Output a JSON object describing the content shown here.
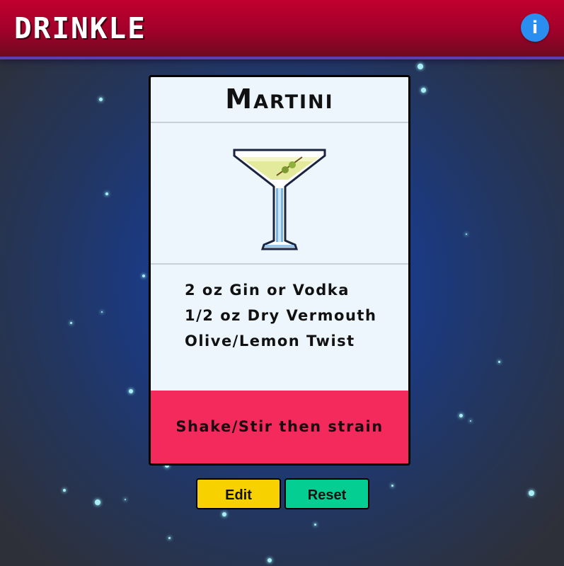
{
  "header": {
    "logo_text": "DRINKLE",
    "info_icon": "info-icon",
    "info_label": "i"
  },
  "card": {
    "title": "Martini",
    "image_icon": "martini-glass-icon",
    "ingredients": [
      "2 oz Gin or Vodka",
      "1/2 oz Dry Vermouth",
      "Olive/Lemon Twist"
    ],
    "method": "Shake/Stir then strain"
  },
  "actions": {
    "edit_label": "Edit",
    "reset_label": "Reset"
  },
  "colors": {
    "header": "#c2002e",
    "info_button": "#2a8df0",
    "method_bar": "#f52a5c",
    "edit_button": "#f7d100",
    "reset_button": "#05ce93"
  }
}
